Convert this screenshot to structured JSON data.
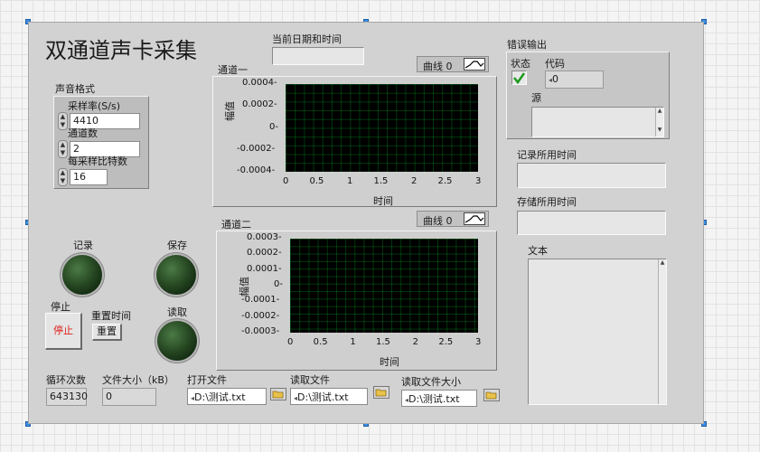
{
  "panel": {
    "title": "双通道声卡采集"
  },
  "datetime": {
    "label": "当前日期和时间",
    "value": ""
  },
  "sound_format": {
    "label": "声音格式",
    "sample_rate_label": "采样率(S/s)",
    "sample_rate_value": "4410",
    "channels_label": "通道数",
    "channels_value": "2",
    "bits_label": "每采样比特数",
    "bits_value": "16"
  },
  "error_out": {
    "label": "错误输出",
    "status_label": "状态",
    "code_label": "代码",
    "code_value": "0",
    "source_label": "源",
    "status_icon": "checkmark-icon"
  },
  "record_time": {
    "label": "记录所用时间",
    "value": ""
  },
  "save_time": {
    "label": "存储所用时间",
    "value": ""
  },
  "text_out": {
    "label": "文本",
    "value": ""
  },
  "leds": {
    "record_label": "记录",
    "save_label": "保存",
    "read_label": "读取"
  },
  "stop": {
    "label": "停止",
    "button_text": "停止",
    "text_color": "#e0201c"
  },
  "reset": {
    "label": "重置时间",
    "button_text": "重置"
  },
  "loop": {
    "label": "循环次数",
    "value": "643130"
  },
  "filesize": {
    "label": "文件大小（kB）",
    "value": "0"
  },
  "open_file": {
    "label": "打开文件",
    "path": "D:\\测试.txt"
  },
  "read_file": {
    "label": "读取文件",
    "path": "D:\\测试.txt"
  },
  "read_file_size": {
    "label": "读取文件大小",
    "path": "D:\\测试.txt"
  },
  "colors": {
    "panel": "#d2d2d2",
    "plot_bg": "#000000",
    "grid": "#00a028"
  },
  "chart_data": [
    {
      "type": "line",
      "title": "通道一",
      "xlabel": "时间",
      "ylabel": "幅值",
      "legend": "曲线 0",
      "xlim": [
        0,
        3
      ],
      "ylim": [
        -0.0004,
        0.0004
      ],
      "x_ticks": [
        "0",
        "0.5",
        "1",
        "1.5",
        "2",
        "2.5",
        "3"
      ],
      "y_ticks": [
        "0.0004",
        "0.0002",
        "0",
        "-0.0002",
        "-0.0004"
      ],
      "series": [
        {
          "name": "曲线 0",
          "values": []
        }
      ],
      "grid": true
    },
    {
      "type": "line",
      "title": "通道二",
      "xlabel": "时间",
      "ylabel": "幅值",
      "legend": "曲线 0",
      "xlim": [
        0,
        3
      ],
      "ylim": [
        -0.0003,
        0.0003
      ],
      "x_ticks": [
        "0",
        "0.5",
        "1",
        "1.5",
        "2",
        "2.5",
        "3"
      ],
      "y_ticks": [
        "0.0003",
        "0.0002",
        "0.0001",
        "0",
        "-0.0001",
        "-0.0002",
        "-0.0003"
      ],
      "series": [
        {
          "name": "曲线 0",
          "values": []
        }
      ],
      "grid": true
    }
  ]
}
